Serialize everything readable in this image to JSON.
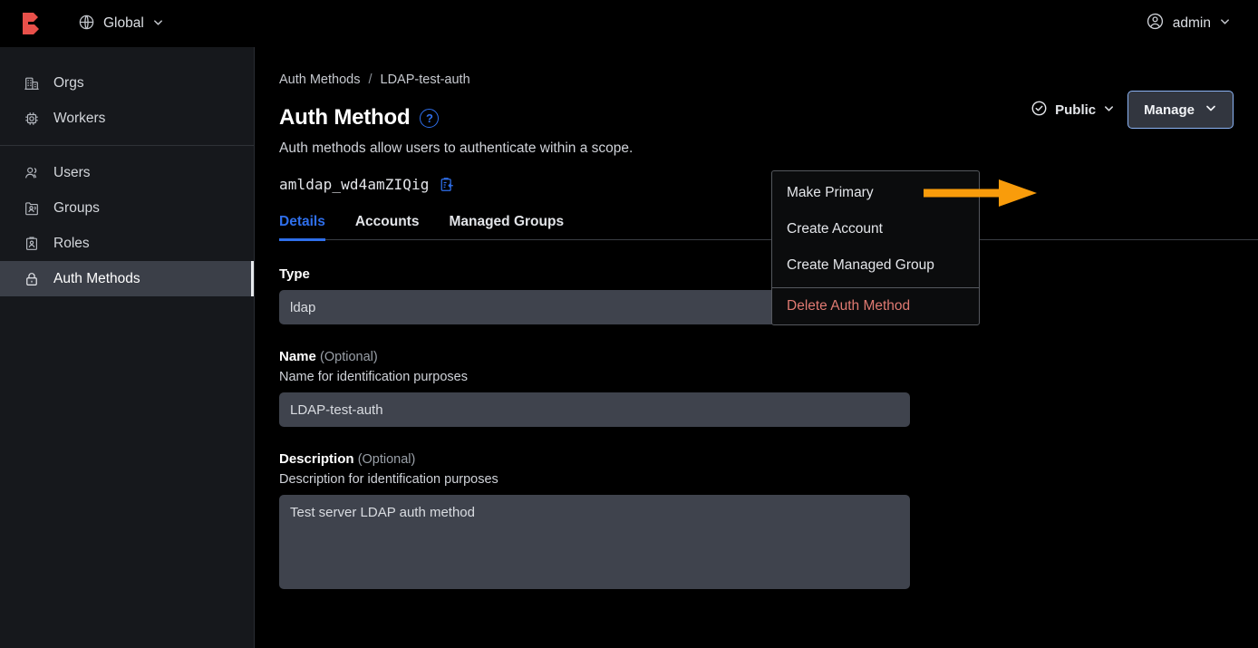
{
  "app": {
    "brand": "boundary-logo",
    "scope": {
      "icon": "globe-icon",
      "label": "Global",
      "chevron": "chevron-down-icon"
    },
    "user": {
      "icon": "user-circle-icon",
      "label": "admin",
      "chevron": "chevron-down-icon"
    }
  },
  "sidebar": {
    "groups": [
      {
        "items": [
          {
            "icon": "building-icon",
            "label": "Orgs",
            "active": false
          },
          {
            "icon": "cpu-icon",
            "label": "Workers",
            "active": false
          }
        ]
      },
      {
        "items": [
          {
            "icon": "users-icon",
            "label": "Users",
            "active": false
          },
          {
            "icon": "user-group-folder-icon",
            "label": "Groups",
            "active": false
          },
          {
            "icon": "id-badge-icon",
            "label": "Roles",
            "active": false
          },
          {
            "icon": "lock-icon",
            "label": "Auth Methods",
            "active": true
          }
        ]
      }
    ]
  },
  "breadcrumb": {
    "parent": "Auth Methods",
    "separator": "/",
    "current": "LDAP-test-auth"
  },
  "page": {
    "title": "Auth Method",
    "help_icon": "question-mark-icon",
    "help_glyph": "?",
    "description": "Auth methods allow users to authenticate within a scope.",
    "resource_id": "amldap_wd4amZIQig",
    "copy_icon": "copy-clipboard-icon"
  },
  "tabs": [
    {
      "label": "Details",
      "active": true
    },
    {
      "label": "Accounts",
      "active": false
    },
    {
      "label": "Managed Groups",
      "active": false
    }
  ],
  "actions": {
    "visibility": {
      "icon": "check-circle-icon",
      "label": "Public",
      "chevron": "chevron-down-icon"
    },
    "manage": {
      "label": "Manage",
      "chevron": "chevron-down-icon"
    }
  },
  "menu": {
    "items": [
      {
        "label": "Make Primary",
        "danger": false
      },
      {
        "label": "Create Account",
        "danger": false
      },
      {
        "label": "Create Managed Group",
        "danger": false
      }
    ],
    "danger_item": {
      "label": "Delete Auth Method",
      "danger": true
    }
  },
  "form": {
    "type": {
      "label": "Type",
      "value": "ldap"
    },
    "name": {
      "label": "Name",
      "optional": "(Optional)",
      "help": "Name for identification purposes",
      "value": "LDAP-test-auth"
    },
    "description": {
      "label": "Description",
      "optional": "(Optional)",
      "help": "Description for identification purposes",
      "value": "Test server LDAP auth method"
    }
  },
  "annotation": {
    "type": "arrow",
    "color": "#f99c0b",
    "points_to": "Make Primary"
  },
  "colors": {
    "accent_blue": "#2f6feb",
    "brand_red": "#e8504a",
    "danger_red": "#e07a72",
    "annotation_orange": "#f99c0b",
    "sidebar_bg": "#16181c",
    "main_bg": "#000000",
    "input_bg": "#3f434d"
  }
}
